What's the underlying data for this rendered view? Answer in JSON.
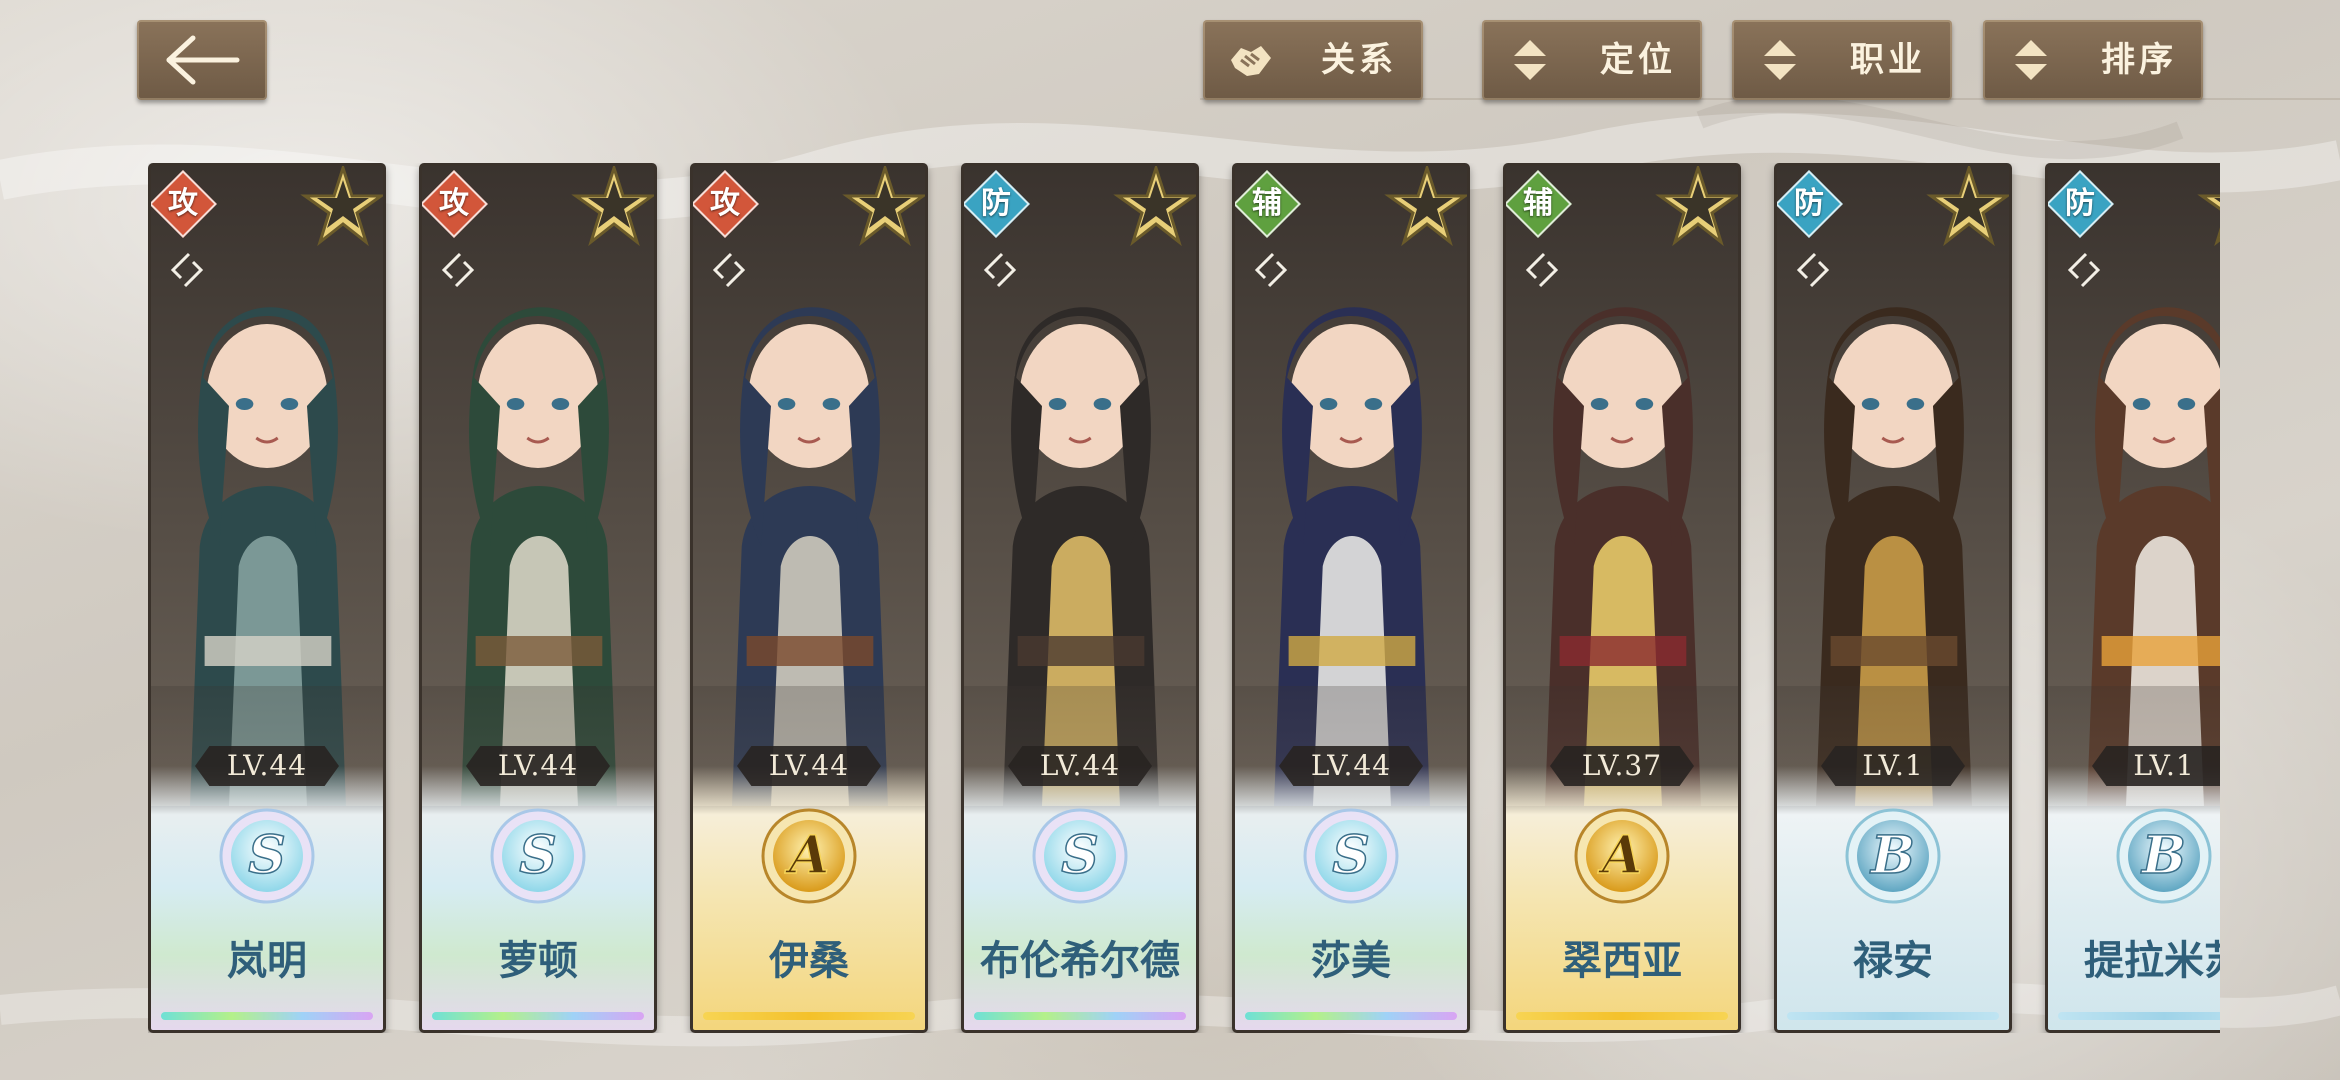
{
  "toolbar": {
    "relation_label": "关系",
    "position_label": "定位",
    "class_label": "职业",
    "sort_label": "排序"
  },
  "colors": {
    "attack": "#d2563a",
    "defense": "#3aa3c2",
    "support": "#5fa03f",
    "button": "#7c6650"
  },
  "heroes": [
    {
      "role": "攻",
      "role_type": "attack",
      "level": "LV.44",
      "tier": "S",
      "name": "岚明",
      "palette": [
        "#2d4a4c",
        "#8aa6a3",
        "#d7d3c8"
      ]
    },
    {
      "role": "攻",
      "role_type": "attack",
      "level": "LV.44",
      "tier": "S",
      "name": "萝顿",
      "palette": [
        "#2d4a3a",
        "#e2dccd",
        "#7a5a3a"
      ]
    },
    {
      "role": "攻",
      "role_type": "attack",
      "level": "LV.44",
      "tier": "A",
      "name": "伊桑",
      "palette": [
        "#2d3a55",
        "#d8d2c3",
        "#7b4a2c"
      ]
    },
    {
      "role": "防",
      "role_type": "defense",
      "level": "LV.44",
      "tier": "S",
      "name": "布伦希尔德",
      "palette": [
        "#2e2a28",
        "#e6c36a",
        "#4a3a2f"
      ]
    },
    {
      "role": "辅",
      "role_type": "support",
      "level": "LV.44",
      "tier": "S",
      "name": "莎美",
      "palette": [
        "#2a2f54",
        "#f1f0ec",
        "#d1aa44"
      ]
    },
    {
      "role": "辅",
      "role_type": "support",
      "level": "LV.37",
      "tier": "A",
      "name": "翠西亚",
      "palette": [
        "#4a2f2a",
        "#f0d26c",
        "#8a2a2f"
      ]
    },
    {
      "role": "防",
      "role_type": "defense",
      "level": "LV.1",
      "tier": "B",
      "name": "禄安",
      "palette": [
        "#3a2a1e",
        "#d1a24a",
        "#6a4a2e"
      ]
    },
    {
      "role": "防",
      "role_type": "defense",
      "level": "LV.1",
      "tier": "B",
      "name": "提拉米苏",
      "palette": [
        "#5a3a2a",
        "#f3efe6",
        "#e9a23a"
      ]
    }
  ]
}
